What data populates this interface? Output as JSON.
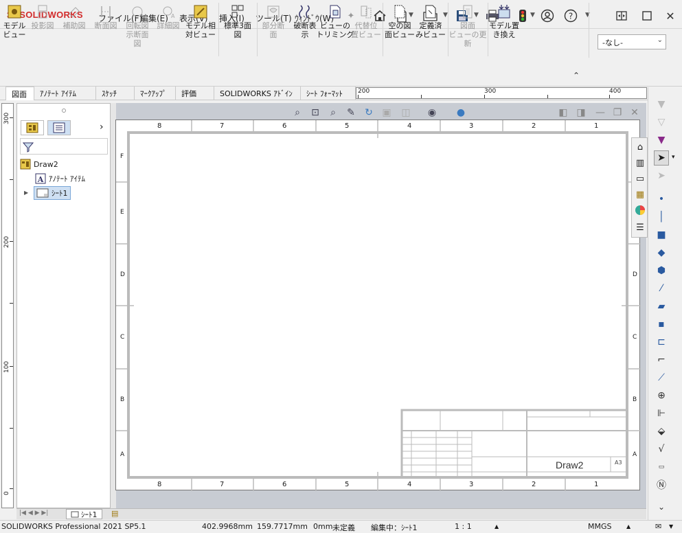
{
  "app": {
    "logo": "SOLIDWORKS",
    "logo_mark": "3S"
  },
  "menu": [
    "ファイル(F)",
    "編集(E)",
    "表示(V)",
    "挿入(I)",
    "ツール(T)",
    "ｳｨﾝﾄﾞｳ(W)"
  ],
  "ribbon": {
    "buttons": [
      {
        "label": "モデル\nビュー",
        "enabled": true
      },
      {
        "label": "投影図",
        "enabled": false
      },
      {
        "label": "補助図",
        "enabled": false
      },
      {
        "label": "断面図",
        "enabled": false
      },
      {
        "label": "回転図\n示断面\n図",
        "enabled": false
      },
      {
        "label": "詳細図",
        "enabled": false
      },
      {
        "label": "モデル相\n対ビュー",
        "enabled": true
      },
      {
        "label": "標準3面\n図",
        "enabled": true
      },
      {
        "label": "部分断\n面",
        "enabled": false
      },
      {
        "label": "破断表\n示",
        "enabled": true
      },
      {
        "label": "ビューの\nトリミング",
        "enabled": true
      },
      {
        "label": "代替位\n置ビュー",
        "enabled": false
      },
      {
        "label": "空の図\n面ビュー",
        "enabled": true
      },
      {
        "label": "定義済\nみビュー",
        "enabled": true
      },
      {
        "label": "図面\nビューの更\n新",
        "enabled": false
      },
      {
        "label": "モデル置\nき換え",
        "enabled": true
      }
    ],
    "layer_select": "-なし-"
  },
  "tabs": [
    "図面",
    "ｱﾉﾃｰﾄ ｱｲﾃﾑ",
    "ｽｹｯﾁ",
    "ﾏｰｸｱｯﾌﾟ",
    "評価",
    "SOLIDWORKS ｱﾄﾞｲﾝ",
    "ｼｰﾄ ﾌｫｰﾏｯﾄ"
  ],
  "ruler": {
    "h_labels": [
      "200",
      "300",
      "400"
    ],
    "v_labels": [
      "300",
      "200",
      "100",
      "0"
    ]
  },
  "tree": {
    "root": "Draw2",
    "items": [
      "ｱﾉﾃｰﾄ ｱｲﾃﾑ",
      "ｼｰﾄ1"
    ]
  },
  "sheet": {
    "col_labels": [
      "8",
      "7",
      "6",
      "5",
      "4",
      "3",
      "2",
      "1"
    ],
    "row_labels": [
      "F",
      "E",
      "D",
      "C",
      "B",
      "A"
    ],
    "title_name": "Draw2",
    "size": "A3"
  },
  "sheet_tab": "ｼｰﾄ1",
  "status": {
    "product": "SOLIDWORKS Professional 2021 SP5.1",
    "x": "402.9968mm",
    "y": "159.7717mm",
    "z": "0mm",
    "state": "未定義",
    "editing": "編集中：ｼｰﾄ1",
    "scale": "1 : 1",
    "units": "MMGS"
  },
  "colors": {
    "accent": "#d22b2b",
    "sheet_border": "#bbbbbb",
    "canvas": "#c8ccd3"
  }
}
